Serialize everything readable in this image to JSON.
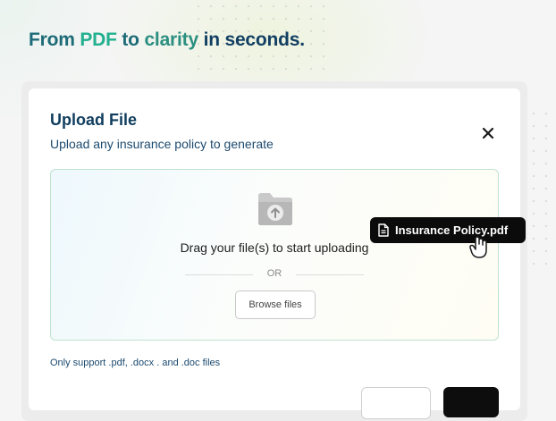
{
  "headline": {
    "part1": "From ",
    "part2": "PDF",
    "part3": " to ",
    "part4": "clarity",
    "part5": " in seconds."
  },
  "modal": {
    "title": "Upload File",
    "subtitle": "Upload any insurance policy to generate",
    "close_icon": "close-icon"
  },
  "dropzone": {
    "icon": "folder-upload-icon",
    "instruction": "Drag your file(s) to start uploading",
    "divider_text": "OR",
    "browse_label": "Browse files"
  },
  "support_note": "Only support .pdf, .docx . and .doc files",
  "dragged_file": {
    "icon": "document-icon",
    "name": "Insurance Policy.pdf",
    "cursor": "hand-grab-cursor-icon"
  },
  "colors": {
    "headline_teal": "#1d6b78",
    "headline_green": "#22b08f",
    "title_navy": "#0f3d5e",
    "dropzone_border": "#bfe3cf",
    "chip_bg": "#0b0b0b"
  }
}
